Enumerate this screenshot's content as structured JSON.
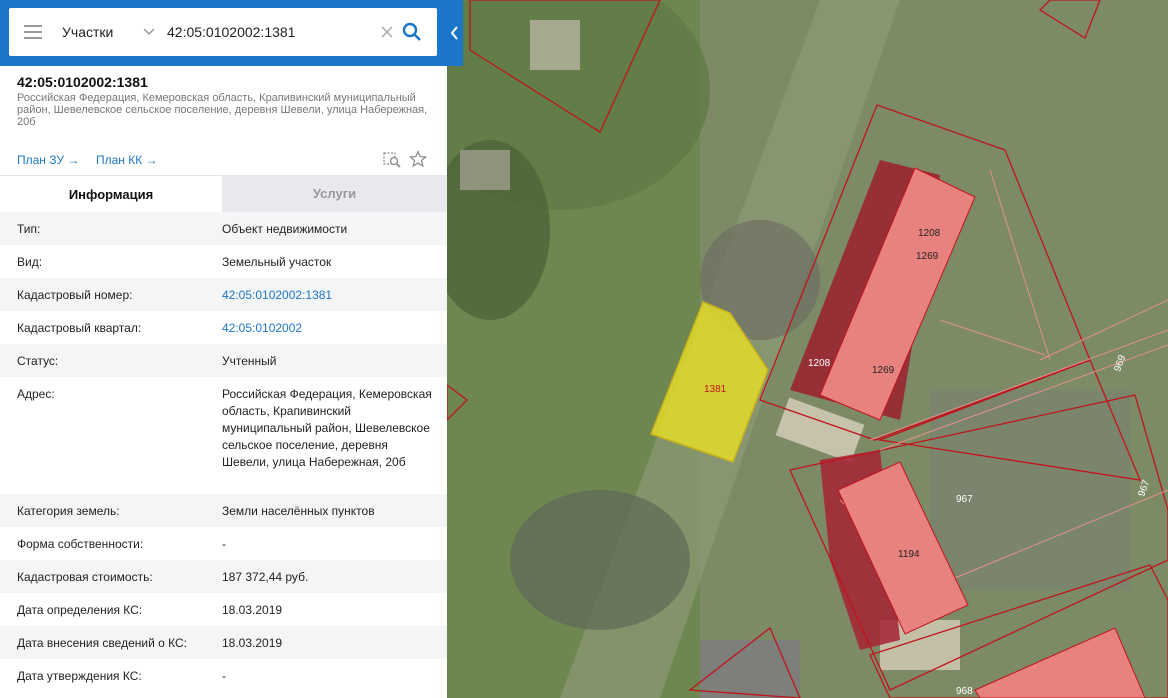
{
  "search": {
    "category": "Участки",
    "query": "42:05:0102002:1381"
  },
  "object": {
    "title": "42:05:0102002:1381",
    "address": "Российская Федерация, Кемеровская область, Крапивинский муниципальный район, Шевелевское сельское поселение, деревня Шевели, улица Набережная, 20б",
    "plan_zu": "План ЗУ →",
    "plan_kk": "План КК →"
  },
  "tabs": {
    "info": "Информация",
    "services": "Услуги"
  },
  "info_rows": [
    {
      "label": "Тип:",
      "value": "Объект недвижимости"
    },
    {
      "label": "Вид:",
      "value": "Земельный участок"
    },
    {
      "label": "Кадастровый номер:",
      "value": "42:05:0102002:1381"
    },
    {
      "label": "Кадастровый квартал:",
      "value": "42:05:0102002"
    },
    {
      "label": "Статус:",
      "value": "Учтенный"
    },
    {
      "label": "Адрес:",
      "value": "Российская Федерация, Кемеровская область, Крапивинский муниципальный район, Шевелевское сельское поселение, деревня Шевели, улица Набережная, 20б"
    },
    {
      "label": "Категория земель:",
      "value": "Земли населённых пунктов"
    },
    {
      "label": "Форма собственности:",
      "value": "-"
    },
    {
      "label": "Кадастровая стоимость:",
      "value": "187 372,44 руб."
    },
    {
      "label": "Дата определения КС:",
      "value": "18.03.2019"
    },
    {
      "label": "Дата внесения сведений о КС:",
      "value": "18.03.2019"
    },
    {
      "label": "Дата утверждения КС:",
      "value": "-"
    }
  ],
  "map_labels": {
    "selected_parcel": "1381",
    "b1208a": "1208",
    "b1269a": "1269",
    "b1208b": "1208",
    "b1269b": "1269",
    "p969a": "969",
    "p967a": "967",
    "p967b": "967",
    "b1194": "1194",
    "p968": "968"
  },
  "colors": {
    "accent": "#1b76c9",
    "parcel_border": "#c0141c",
    "building_fill": "#e8827e",
    "selected_fill": "#e3dc2a"
  }
}
